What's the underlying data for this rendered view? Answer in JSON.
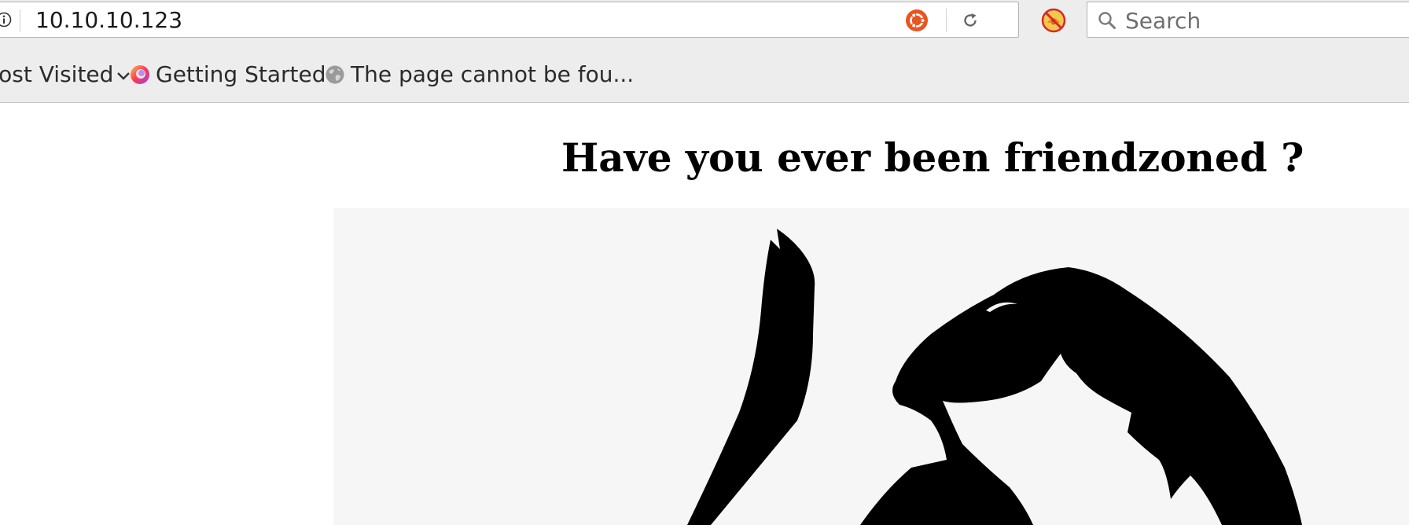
{
  "browser": {
    "url": "10.10.10.123",
    "search_placeholder": "Search"
  },
  "bookmarks": {
    "most_visited": "Most Visited",
    "getting_started": "Getting Started",
    "page_not_found": "The page cannot be fou..."
  },
  "icons": {
    "info": "info-icon",
    "ubuntu": "ubuntu-icon",
    "reload": "reload-icon",
    "noscript": "noscript-icon",
    "search": "search-icon",
    "chevron": "chevron-down-icon",
    "firefox": "firefox-icon",
    "globe": "globe-icon"
  },
  "page": {
    "heading": "Have you ever been friendzoned ?"
  },
  "colors": {
    "ubuntu_orange": "#e95420",
    "noscript_red": "#d8262c",
    "toolbar_bg": "#ededed"
  }
}
